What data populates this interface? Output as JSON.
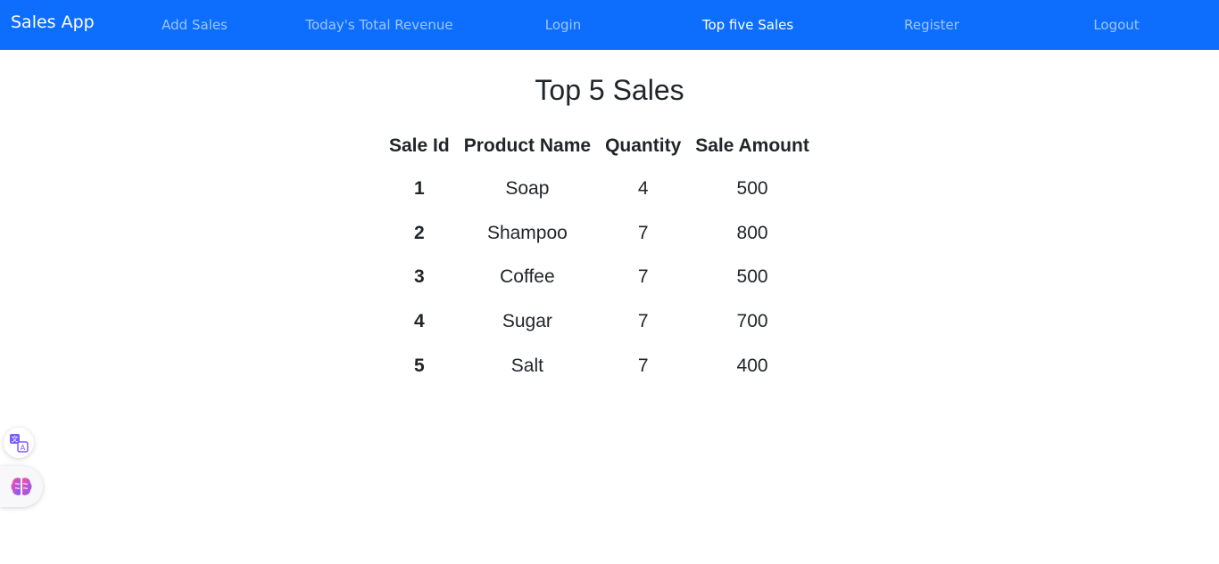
{
  "navbar": {
    "brand": "Sales App",
    "links": [
      {
        "label": "Add Sales",
        "active": false
      },
      {
        "label": "Today's Total Revenue",
        "active": false
      },
      {
        "label": "Login",
        "active": false
      },
      {
        "label": "Top five Sales",
        "active": true
      },
      {
        "label": "Register",
        "active": false
      },
      {
        "label": "Logout",
        "active": false
      }
    ],
    "background_color": "#0d6efd"
  },
  "page": {
    "title": "Top 5 Sales"
  },
  "table": {
    "headers": [
      "Sale Id",
      "Product Name",
      "Quantity",
      "Sale Amount"
    ],
    "rows": [
      [
        "1",
        "Soap",
        "4",
        "500"
      ],
      [
        "2",
        "Shampoo",
        "7",
        "800"
      ],
      [
        "3",
        "Coffee",
        "7",
        "500"
      ],
      [
        "4",
        "Sugar",
        "7",
        "700"
      ],
      [
        "5",
        "Salt",
        "7",
        "400"
      ]
    ]
  },
  "floating_widgets": [
    {
      "icon": "translate-icon"
    },
    {
      "icon": "brain-icon"
    }
  ]
}
